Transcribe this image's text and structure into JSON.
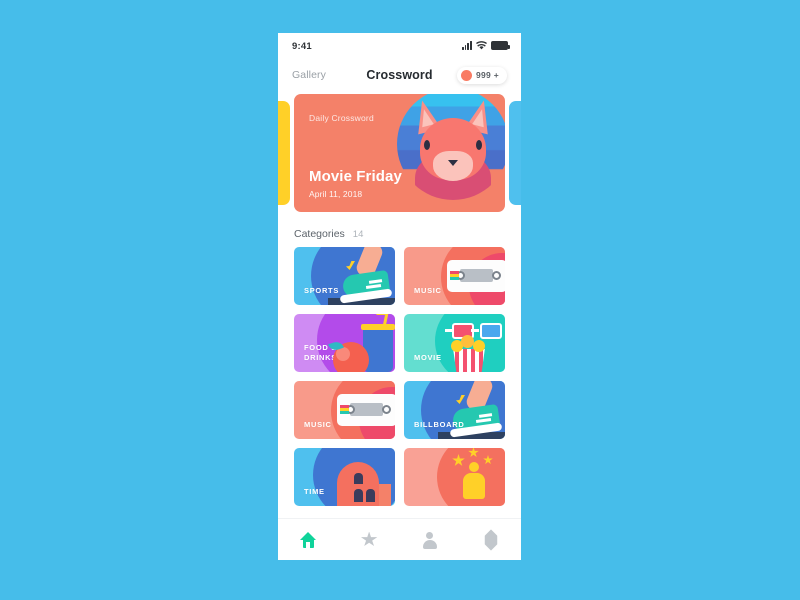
{
  "background_color": "#46bdea",
  "status_bar": {
    "time": "9:41",
    "icons": [
      "signal-bars",
      "wifi",
      "battery"
    ]
  },
  "nav": {
    "back_label": "Gallery",
    "title": "Crossword",
    "badge": {
      "count": "999 +",
      "dot_color": "#f97b63"
    }
  },
  "hero": {
    "eyebrow": "Daily Crossword",
    "title": "Movie Friday",
    "date": "April 11, 2018",
    "card_color": "#f48169",
    "illustration": "fox-avatar",
    "peek_left_color": "#ffd028",
    "peek_right_color": "#4fc0ee"
  },
  "categories": {
    "label": "Categories",
    "count": "14",
    "items": [
      {
        "name": "SPORTS",
        "color": "#4fc0ee",
        "illustration": "sneaker-icon"
      },
      {
        "name": "MUSIC",
        "color": "#f89a8a",
        "illustration": "cassette-icon"
      },
      {
        "name": "FOOD &\nDRINKS",
        "color": "#cf8bf3",
        "illustration": "apple-drink-icon"
      },
      {
        "name": "MOVIE",
        "color": "#63ded0",
        "illustration": "3d-glasses-popcorn-icon"
      },
      {
        "name": "MUSIC",
        "color": "#f89a8a",
        "illustration": "cassette-icon"
      },
      {
        "name": "BILLBOARD",
        "color": "#4fc0ee",
        "illustration": "sneaker-icon"
      },
      {
        "name": "TIME",
        "color": "#4fc0ee",
        "illustration": "building-icon"
      },
      {
        "name": "",
        "color": "#f9a195",
        "illustration": "trophy-stars-icon"
      }
    ]
  },
  "tab_bar": {
    "active_color": "#0fd39a",
    "inactive_color": "#c2c7cc",
    "items": [
      {
        "icon": "home-icon",
        "active": true
      },
      {
        "icon": "star-icon",
        "active": false
      },
      {
        "icon": "person-icon",
        "active": false
      },
      {
        "icon": "tag-icon",
        "active": false
      }
    ]
  }
}
